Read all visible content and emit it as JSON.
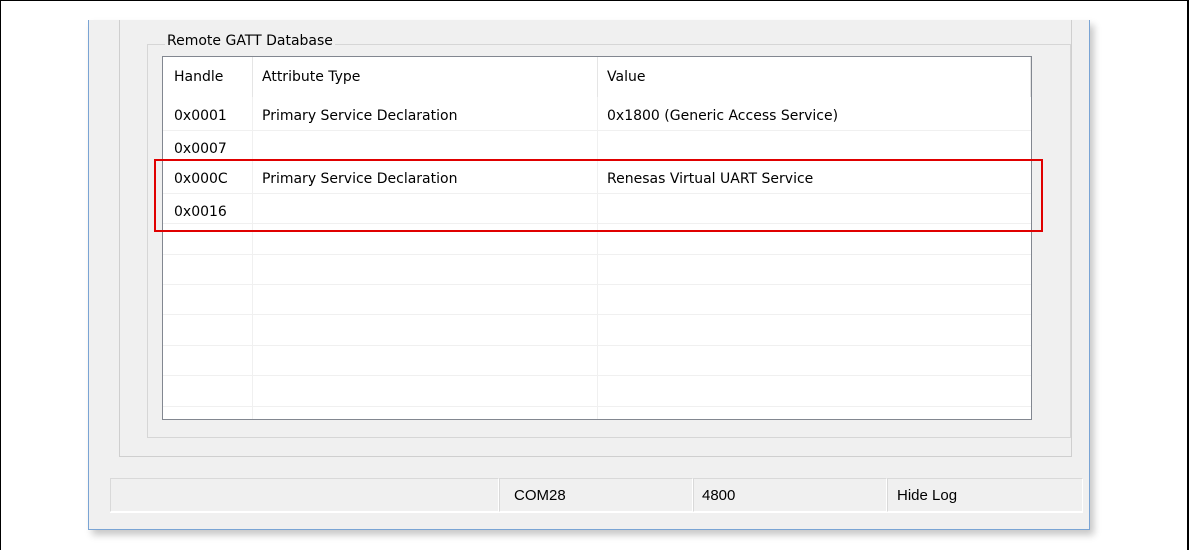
{
  "group": {
    "title": "Remote GATT Database"
  },
  "table": {
    "headers": {
      "handle": "Handle",
      "type": "Attribute Type",
      "value": "Value"
    },
    "rows": [
      {
        "handle": "0x0001",
        "type": "Primary Service Declaration",
        "value": "0x1800 (Generic Access Service)"
      },
      {
        "handle": "0x0007",
        "type": "",
        "value": ""
      },
      {
        "handle": "0x000C",
        "type": "Primary Service Declaration",
        "value": "Renesas Virtual UART Service"
      },
      {
        "handle": "0x0016",
        "type": "",
        "value": ""
      },
      {
        "handle": "",
        "type": "",
        "value": ""
      },
      {
        "handle": "",
        "type": "",
        "value": ""
      },
      {
        "handle": "",
        "type": "",
        "value": ""
      },
      {
        "handle": "",
        "type": "",
        "value": ""
      },
      {
        "handle": "",
        "type": "",
        "value": ""
      },
      {
        "handle": "",
        "type": "",
        "value": ""
      }
    ]
  },
  "status_bar": {
    "port": "COM28",
    "baud": "4800",
    "log_button": "Hide Log"
  },
  "colors": {
    "highlight": "#e00000",
    "window_border": "#7aa4d4"
  }
}
